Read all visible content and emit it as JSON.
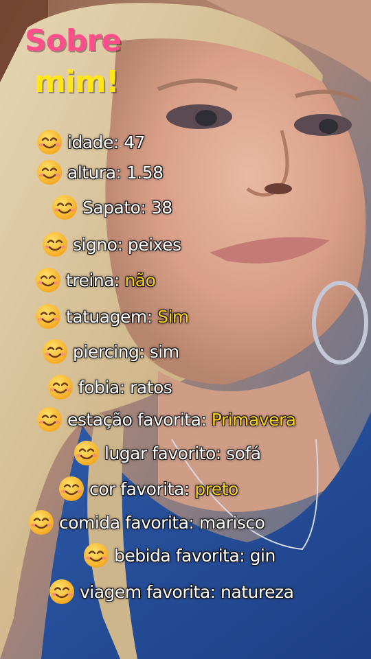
{
  "title": {
    "line1": "Sobre",
    "line2": "mim!"
  },
  "emoji_icon": "smiling-face-emoji",
  "items": [
    {
      "label": "idade:",
      "value": "47",
      "highlight": false
    },
    {
      "label": "altura:",
      "value": "1.58",
      "highlight": false
    },
    {
      "label": "Sapato:",
      "value": "38",
      "highlight": false
    },
    {
      "label": "signo:",
      "value": "peixes",
      "highlight": false
    },
    {
      "label": "treina:",
      "value": "não",
      "highlight": true
    },
    {
      "label": "tatuagem:",
      "value": "Sim",
      "highlight": true
    },
    {
      "label": "piercing:",
      "value": "sim",
      "highlight": false
    },
    {
      "label": "fobia:",
      "value": "ratos",
      "highlight": false
    },
    {
      "label": "estação favorita:",
      "value": "Primavera",
      "highlight": true
    },
    {
      "label": "lugar favorito:",
      "value": "sofá",
      "highlight": false
    },
    {
      "label": "cor favorita:",
      "value": "preto",
      "highlight": true
    },
    {
      "label": "comida favorita:",
      "value": "marisco",
      "highlight": false
    },
    {
      "label": "bebida favorita:",
      "value": "gin",
      "highlight": false
    },
    {
      "label": "viagem  favorita:",
      "value": "natureza",
      "highlight": false
    }
  ],
  "colors": {
    "title_pink": "#ff4f8b",
    "title_yellow": "#ffe61a",
    "highlight": "#ffd21a",
    "text": "#ffffff"
  }
}
